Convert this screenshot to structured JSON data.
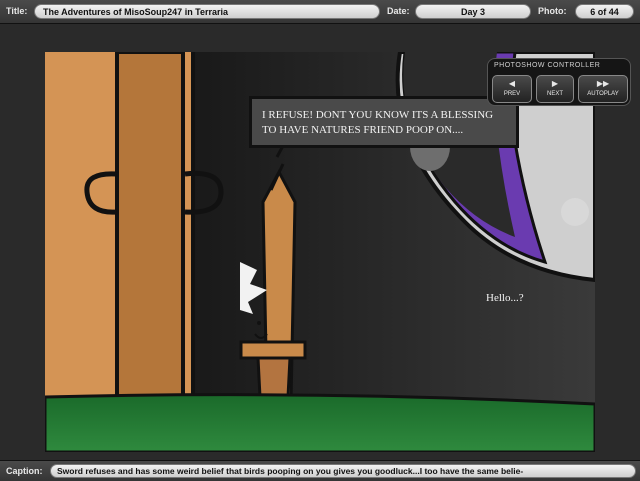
{
  "header": {
    "title_label": "Title:",
    "title_value": "The Adventures of MisoSoup247 in Terraria",
    "date_label": "Date:",
    "date_value": "Day 3",
    "photo_label": "Photo:",
    "photo_value": "6 of 44"
  },
  "controller": {
    "title": "PHOTOSHOW CONTROLLER",
    "prev_label": "PREV",
    "next_label": "NEXT",
    "autoplay_label": "AUTOPLAY",
    "prev_icon": "◀",
    "next_icon": "▶",
    "autoplay_icon": "▶▶"
  },
  "photo": {
    "speech_text": "I REFUSE!  DONT YOU KNOW ITS A BLESSING TO HAVE NATURES FRIEND POOP ON....",
    "hello_text": "Hello...?"
  },
  "caption": {
    "label": "Caption:",
    "text": "Sword refuses and has some weird belief that birds pooping on you gives you goodluck...I too have the same belie-"
  },
  "colors": {
    "bar_bg": "#3e3e3e",
    "pill_bg": "#e0e0e0",
    "grass": "#1f6e2c",
    "wood": "#c98a4a",
    "eye_purple": "#6a3bb0"
  }
}
